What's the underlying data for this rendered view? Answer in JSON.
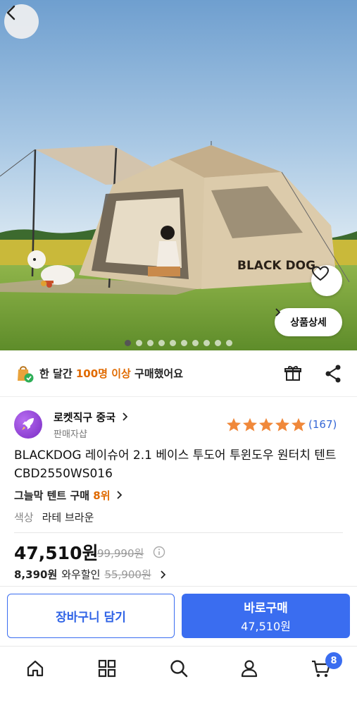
{
  "hero": {
    "image_desc_icon": "tent-photo",
    "tent_brand": "BLACK DOG",
    "detail_button_label": "상품상세",
    "slide_count": 10,
    "active_slide": 1
  },
  "purchase_banner": {
    "prefix": "한 달간 ",
    "highlight": "100명 이상",
    "suffix": " 구매했어요"
  },
  "seller": {
    "name": "로켓직구 중국",
    "subtitle": "판매자샵"
  },
  "rating": {
    "stars": 5,
    "review_count": "(167)"
  },
  "product": {
    "title": "BLACKDOG 레이슈어 2.1 베이스 투도어 투윈도우 원터치 텐트 CBD2550WS016",
    "rank_prefix": "그늘막 텐트 구매 ",
    "rank_value": "8위",
    "option_label": "색상",
    "option_value": "라테 브라운"
  },
  "pricing": {
    "price": "47,510원",
    "original_price": "99,990원",
    "wow_price": "8,390원",
    "wow_label": "와우할인",
    "wow_original": "55,900원"
  },
  "actions": {
    "cart_label": "장바구니 담기",
    "buy_label": "바로구매",
    "buy_price": "47,510원"
  },
  "tabbar": {
    "items": [
      "home-icon",
      "category-icon",
      "search-icon",
      "user-icon",
      "cart-icon"
    ],
    "cart_badge": "8"
  },
  "colors": {
    "accent_blue": "#3a6df0",
    "highlight_orange": "#e06a00",
    "star_orange": "#f0883a"
  }
}
